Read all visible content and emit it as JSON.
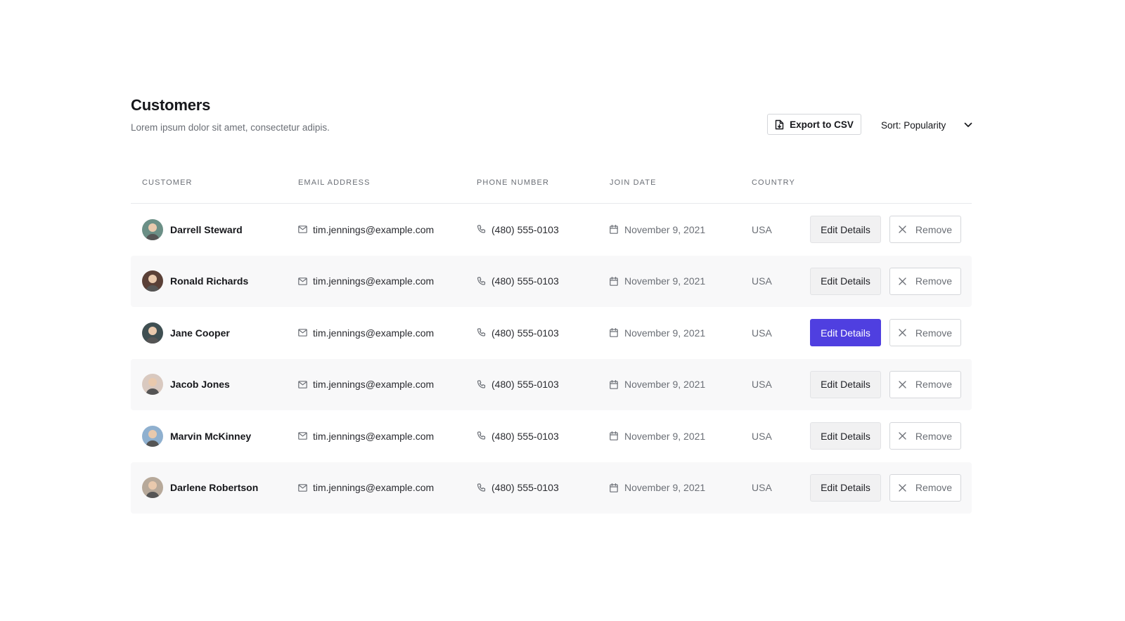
{
  "header": {
    "title": "Customers",
    "subtitle": "Lorem ipsum dolor sit amet, consectetur adipis.",
    "export_label": "Export to CSV",
    "sort_label": "Sort: Popularity"
  },
  "table": {
    "columns": [
      "CUSTOMER",
      "EMAIL ADDRESS",
      "PHONE NUMBER",
      "JOIN DATE",
      "COUNTRY"
    ],
    "edit_label": "Edit Details",
    "remove_label": "Remove",
    "rows": [
      {
        "name": "Darrell Steward",
        "email": "tim.jennings@example.com",
        "phone": "(480) 555-0103",
        "join_date": "November 9, 2021",
        "country": "USA",
        "avatar_color": "#6b8f86",
        "highlight": false
      },
      {
        "name": "Ronald Richards",
        "email": "tim.jennings@example.com",
        "phone": "(480) 555-0103",
        "join_date": "November 9, 2021",
        "country": "USA",
        "avatar_color": "#5a4037",
        "highlight": false
      },
      {
        "name": "Jane Cooper",
        "email": "tim.jennings@example.com",
        "phone": "(480) 555-0103",
        "join_date": "November 9, 2021",
        "country": "USA",
        "avatar_color": "#3f4f52",
        "highlight": true
      },
      {
        "name": "Jacob Jones",
        "email": "tim.jennings@example.com",
        "phone": "(480) 555-0103",
        "join_date": "November 9, 2021",
        "country": "USA",
        "avatar_color": "#d9c9c0",
        "highlight": false
      },
      {
        "name": "Marvin McKinney",
        "email": "tim.jennings@example.com",
        "phone": "(480) 555-0103",
        "join_date": "November 9, 2021",
        "country": "USA",
        "avatar_color": "#8fb0cf",
        "highlight": false
      },
      {
        "name": "Darlene Robertson",
        "email": "tim.jennings@example.com",
        "phone": "(480) 555-0103",
        "join_date": "November 9, 2021",
        "country": "USA",
        "avatar_color": "#b7a99a",
        "highlight": false
      }
    ]
  },
  "colors": {
    "accent": "#4f3fe0",
    "row_alt": "#f8f8f9",
    "muted_text": "#6b6f76"
  }
}
